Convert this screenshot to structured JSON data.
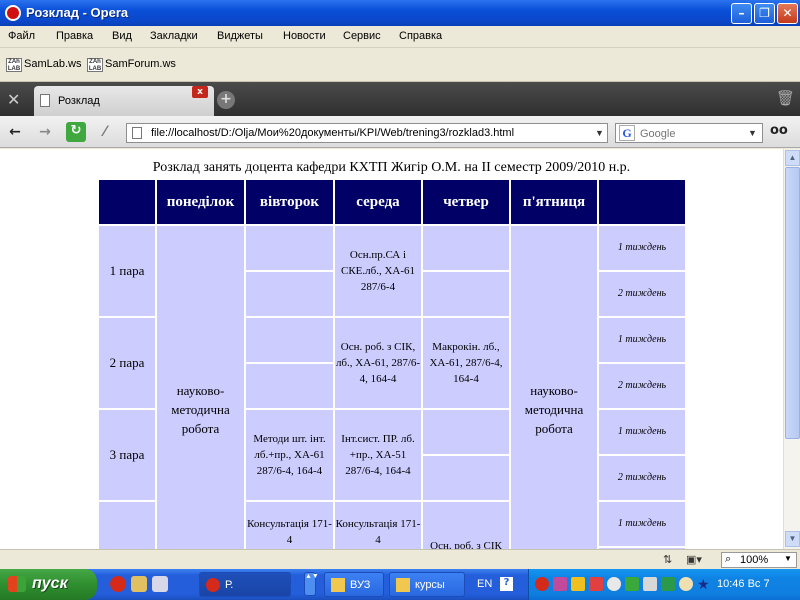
{
  "window": {
    "title": "Розклад - Opera"
  },
  "menu": [
    "Файл",
    "Правка",
    "Вид",
    "Закладки",
    "Виджеты",
    "Новости",
    "Сервис",
    "Справка"
  ],
  "bookmarks": [
    {
      "label": "SamLab.ws",
      "icon_text": "ZAh LAB"
    },
    {
      "label": "SamForum.ws",
      "icon_text": "ZAh LAB"
    }
  ],
  "tab": {
    "label": "Розклад"
  },
  "address": {
    "url": "file://localhost/D:/Olja/Мои%20документы/KPI/Web/trening3/rozklad3.html"
  },
  "search": {
    "placeholder": "Google",
    "engine_letter": "G"
  },
  "page": {
    "caption": "Розклад занять доцента кафедри КХТП Жигір О.М. на II семестр 2009/2010 н.р.",
    "days": [
      "понеділок",
      "вівторок",
      "середа",
      "четвер",
      "п'ятниця"
    ],
    "pairs": [
      "1 пара",
      "2 пара",
      "3 пара"
    ],
    "weeks": [
      "1 тиждень",
      "2 тиждень"
    ],
    "monday": "науково-методична робота",
    "friday": "науково-методична робота",
    "cells": {
      "wed_p1": "Осн.пр.СА і СКЕ.лб., ХА-61 287/6-4",
      "wed_p2": "Осн. роб. з СІК, лб., ХА-61, 287/6-4, 164-4",
      "thu_p2": "Макрокін. лб., ХА-61, 287/6-4, 164-4",
      "tue_p3": "Методи шт. інт. лб.+пр., ХА-61 287/6-4, 164-4",
      "wed_p3": "Інт.сист. ПР. лб. +пр., ХА-51 287/6-4, 164-4",
      "tue_p4": "Консультація 171-4",
      "wed_p4": "Консультація 171-4",
      "thu_p4": "Осн. роб. з СІК"
    }
  },
  "status": {
    "zoom": "100%"
  },
  "taskbar": {
    "start_label": "пуск",
    "tasks": [
      "Р.",
      "ВУЗ",
      "курсы"
    ],
    "lang": "EN",
    "clock": "10:46 Вс 7"
  },
  "colors": {
    "header_bg": "#000066",
    "cell_bg": "#ccccff",
    "titlebar": "#0a4fd8",
    "taskbar": "#245edb"
  }
}
